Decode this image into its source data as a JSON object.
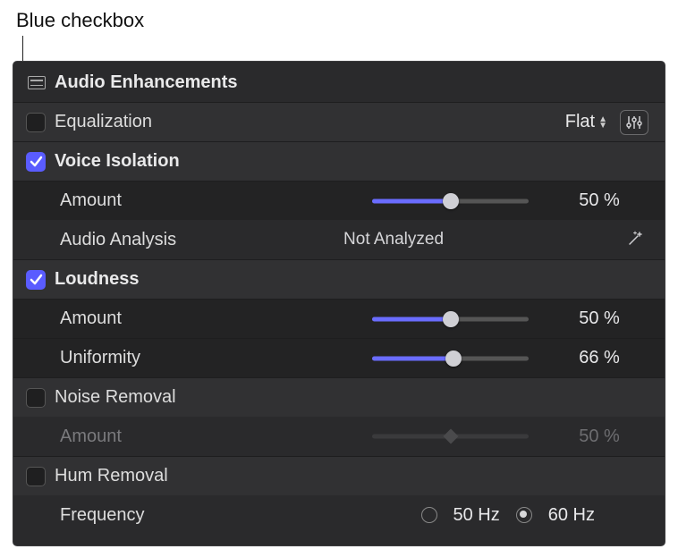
{
  "callout": "Blue checkbox",
  "panel": {
    "title": "Audio Enhancements",
    "equalization": {
      "label": "Equalization",
      "checked": false,
      "preset": "Flat"
    },
    "voiceIsolation": {
      "label": "Voice Isolation",
      "checked": true,
      "amount": {
        "label": "Amount",
        "value": 50,
        "display": "50  %"
      },
      "analysis": {
        "label": "Audio Analysis",
        "status": "Not Analyzed"
      }
    },
    "loudness": {
      "label": "Loudness",
      "checked": true,
      "amount": {
        "label": "Amount",
        "value": 50,
        "display": "50  %"
      },
      "uniformity": {
        "label": "Uniformity",
        "value": 66,
        "display": "66  %"
      }
    },
    "noiseRemoval": {
      "label": "Noise Removal",
      "checked": false,
      "amount": {
        "label": "Amount",
        "value": 50,
        "display": "50  %"
      }
    },
    "humRemoval": {
      "label": "Hum Removal",
      "checked": false,
      "frequency": {
        "label": "Frequency",
        "opt1": "50 Hz",
        "opt2": "60 Hz",
        "selected": "60 Hz"
      }
    }
  }
}
